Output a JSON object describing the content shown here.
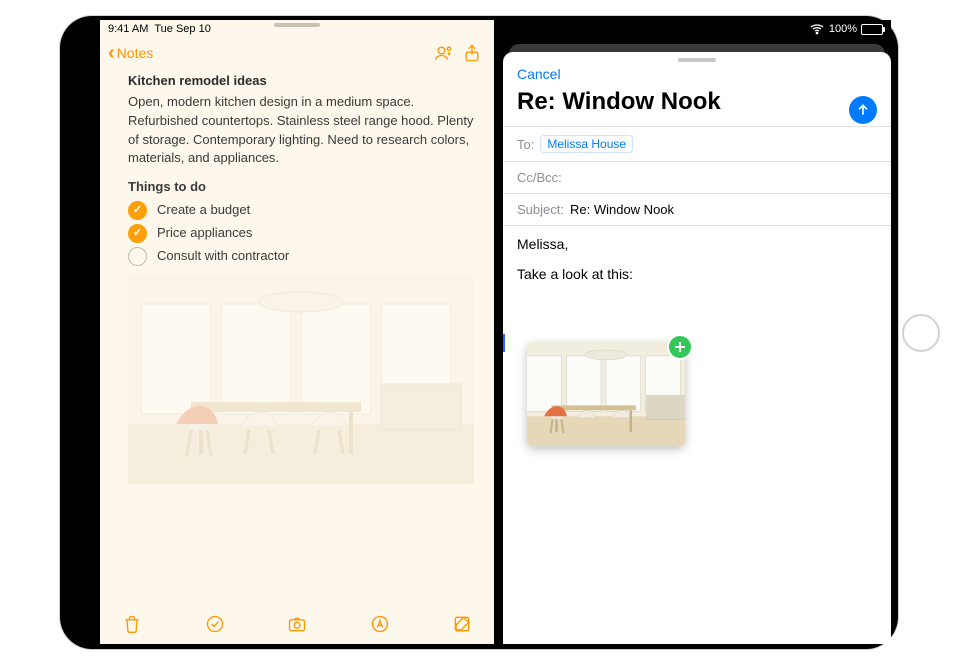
{
  "status_left": {
    "time": "9:41 AM",
    "date": "Tue Sep 10"
  },
  "status_right": {
    "battery_pct": "100%",
    "battery_level": 100
  },
  "notes": {
    "nav": {
      "back_label": "Notes",
      "timestamp": ""
    },
    "title": "Kitchen remodel ideas",
    "paragraph": "Open, modern kitchen design in a medium space. Refurbished countertops. Stainless steel range hood. Plenty of storage. Contemporary lighting. Need to research colors, materials, and appliances.",
    "subhead": "Things to do",
    "todos": [
      {
        "label": "Create a budget",
        "checked": true
      },
      {
        "label": "Price appliances",
        "checked": true
      },
      {
        "label": "Consult with contractor",
        "checked": false
      }
    ]
  },
  "mail": {
    "cancel_label": "Cancel",
    "title": "Re: Window Nook",
    "fields": {
      "to_label": "To:",
      "to_recipient": "Melissa House",
      "cc_label": "Cc/Bcc:",
      "cc_value": "",
      "subject_label": "Subject:",
      "subject_value": "Re: Window Nook"
    },
    "body_lines": [
      "Melissa,",
      "Take a look at this:"
    ]
  }
}
